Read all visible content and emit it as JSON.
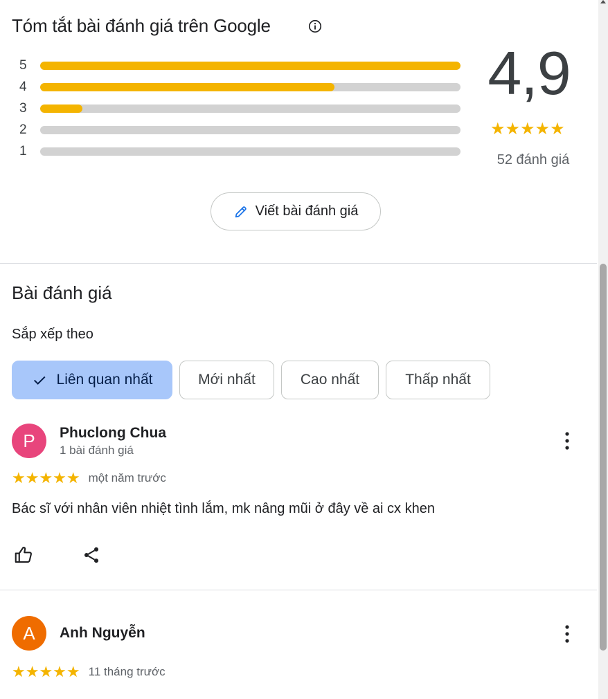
{
  "summary": {
    "title": "Tóm tắt bài đánh giá trên Google",
    "info_icon": "info-circle-icon",
    "distribution": [
      {
        "stars": "5",
        "fraction": 1.0
      },
      {
        "stars": "4",
        "fraction": 0.7
      },
      {
        "stars": "3",
        "fraction": 0.1
      },
      {
        "stars": "2",
        "fraction": 0.0
      },
      {
        "stars": "1",
        "fraction": 0.0
      }
    ],
    "average": "4,9",
    "average_stars": "★★★★★",
    "count_label": "52 đánh giá",
    "write_button_label": "Viết bài đánh giá",
    "write_icon": "pencil-icon"
  },
  "reviews_section": {
    "title": "Bài đánh giá",
    "sort_label": "Sắp xếp theo",
    "sort_options": [
      {
        "label": "Liên quan nhất",
        "selected": true
      },
      {
        "label": "Mới nhất",
        "selected": false
      },
      {
        "label": "Cao nhất",
        "selected": false
      },
      {
        "label": "Thấp nhất",
        "selected": false
      }
    ]
  },
  "reviews": [
    {
      "initial": "P",
      "avatar_color": "#e8457c",
      "author": "Phuclong Chua",
      "meta": "1 bài đánh giá",
      "stars": "★★★★★",
      "rating": 5,
      "time": "một năm trước",
      "text": "Bác sĩ với nhân viên nhiệt tình lắm, mk nâng mũi ở đây về ai cx khen"
    },
    {
      "initial": "A",
      "avatar_color": "#ef6c00",
      "author": "Anh Nguyễn",
      "stars": "★★★★★",
      "rating": 5,
      "time": "11 tháng trước"
    }
  ],
  "colors": {
    "star": "#f4b400",
    "bar_track": "#d2d2d2",
    "chip_selected": "#a8c7fa"
  }
}
